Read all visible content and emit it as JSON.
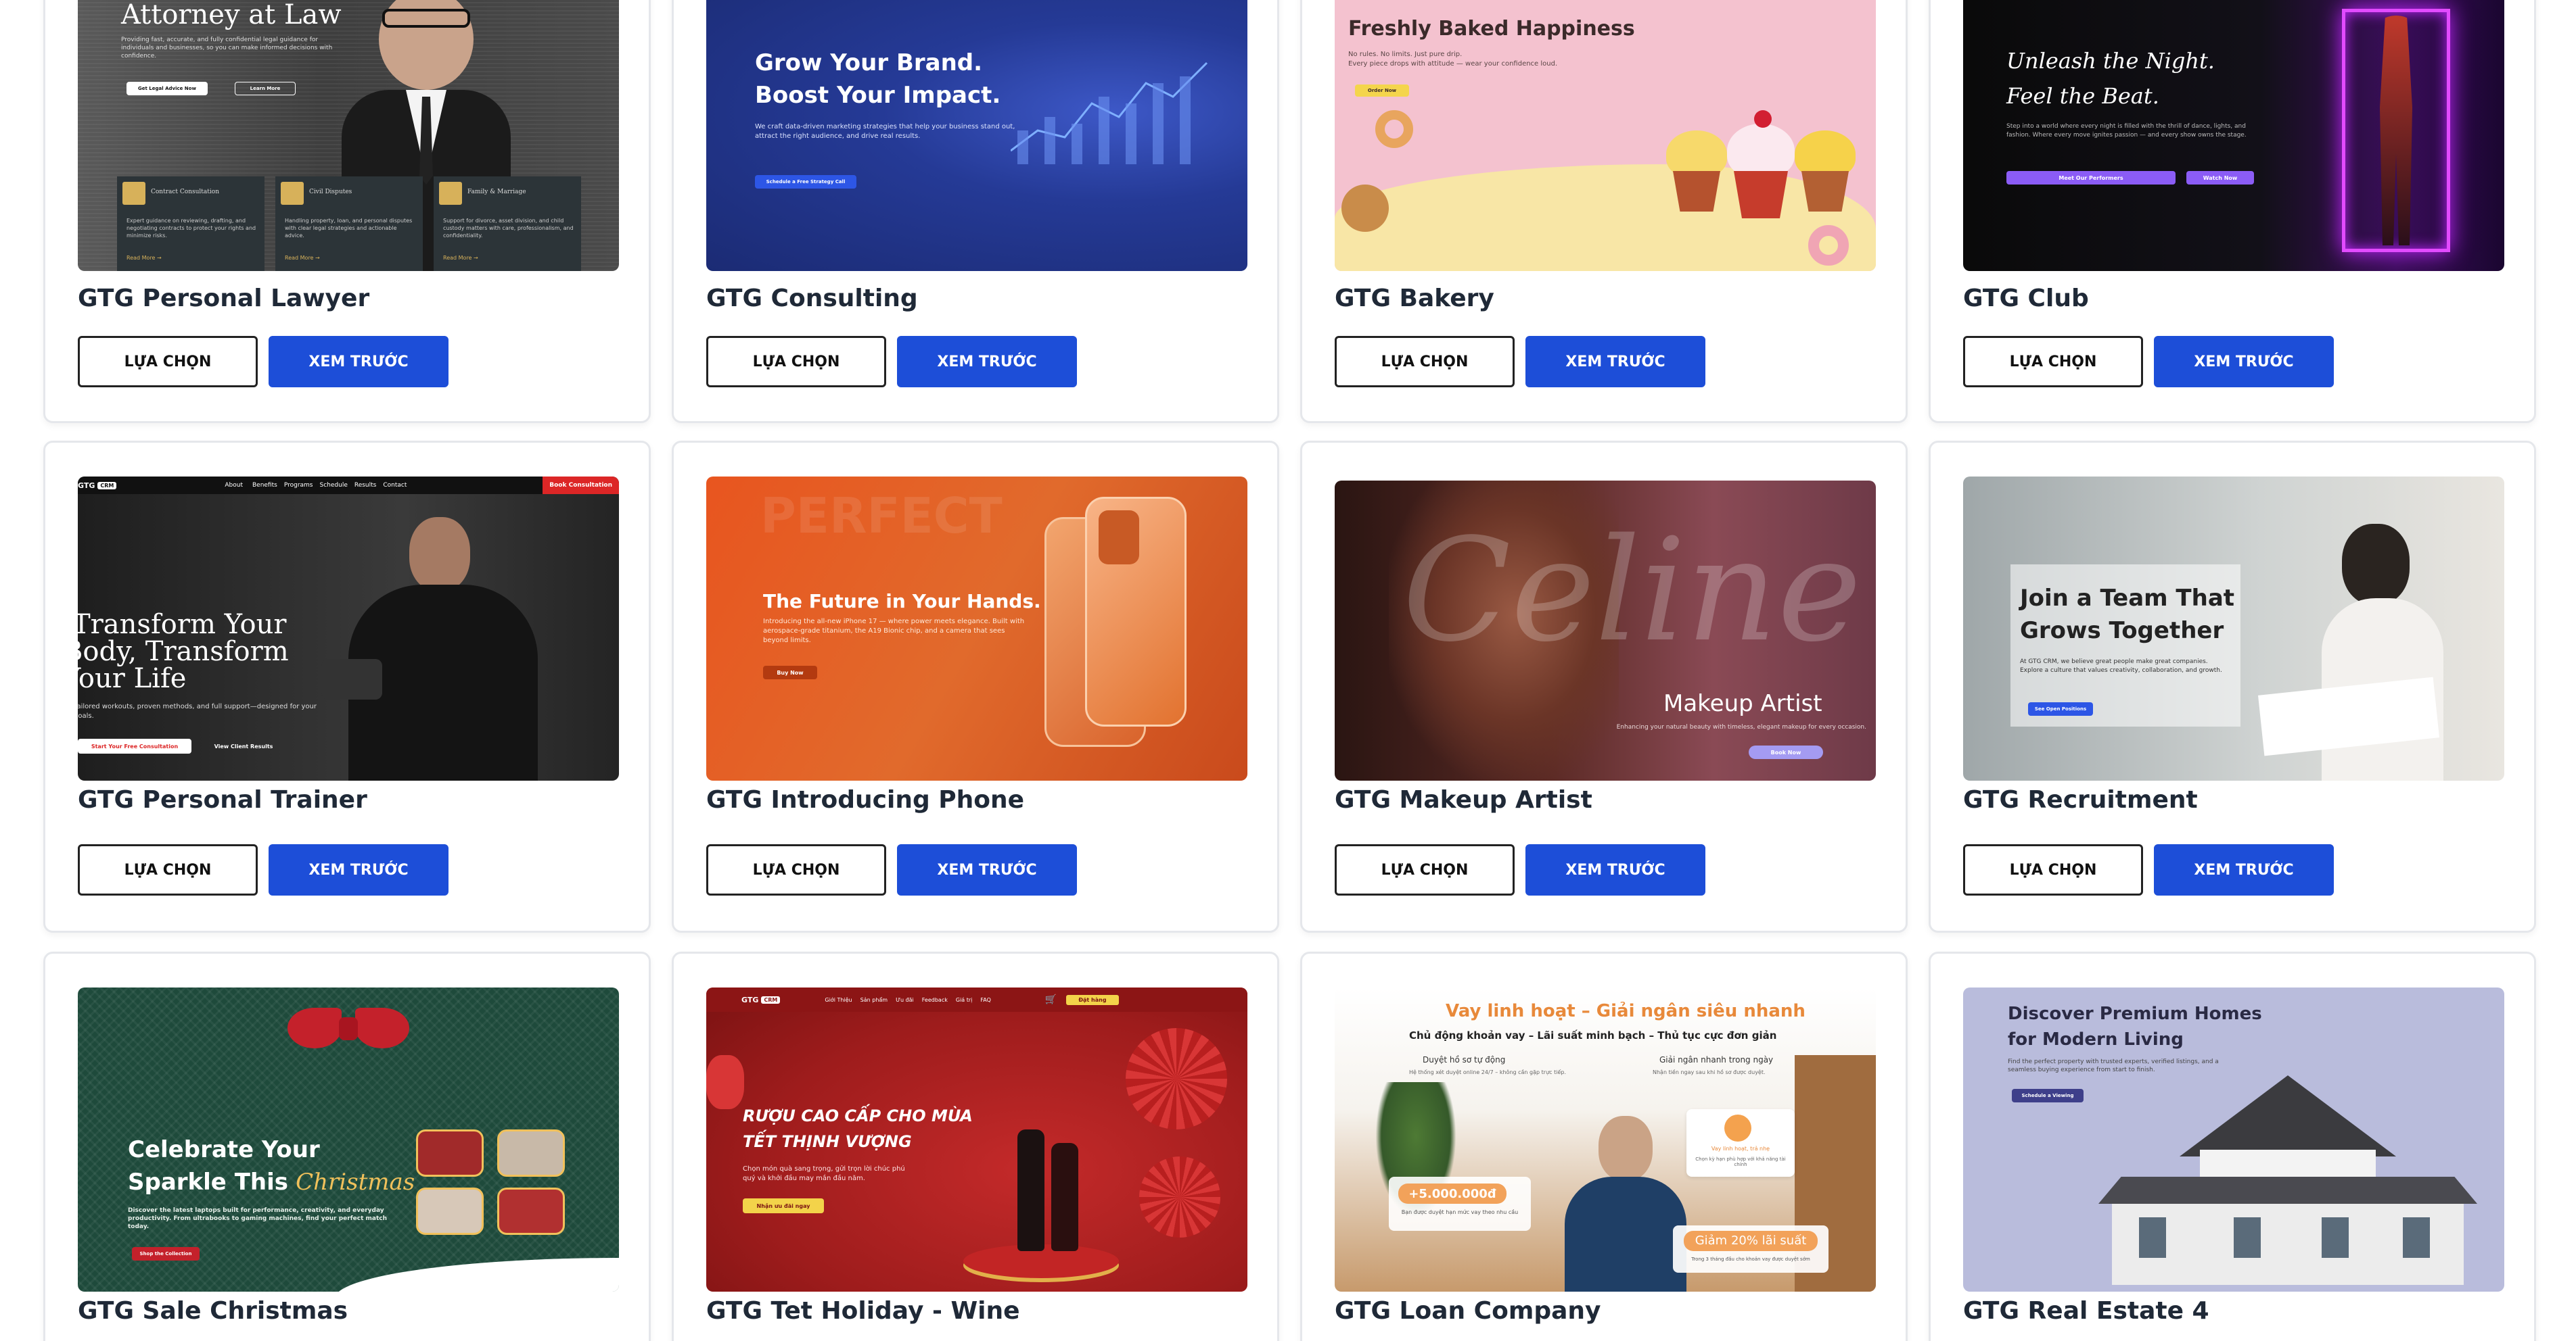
{
  "buttons": {
    "select": "LỰA CHỌN",
    "preview": "XEM TRƯỚC"
  },
  "templates": [
    {
      "name": "GTG Personal Lawyer",
      "hero": {
        "heading": "Attorney at Law",
        "text": "Providing fast, accurate, and fully confidential legal guidance for individuals and businesses, so you can make informed decisions with confidence.",
        "cta_primary": "Get Legal Advice Now",
        "cta_secondary": "Learn More",
        "services": [
          {
            "title": "Contract Consultation",
            "text": "Expert guidance on reviewing, drafting, and negotiating contracts to protect your rights and minimize risks.",
            "link": "Read More →"
          },
          {
            "title": "Civil Disputes",
            "text": "Handling property, loan, and personal disputes with clear legal strategies and actionable advice.",
            "link": "Read More →"
          },
          {
            "title": "Family & Marriage",
            "text": "Support for divorce, asset division, and child custody matters with care, professionalism, and confidentiality.",
            "link": "Read More →"
          }
        ]
      }
    },
    {
      "name": "GTG Consulting",
      "hero": {
        "heading_1": "Grow Your Brand.",
        "heading_2": "Boost Your Impact.",
        "text": "We craft data-driven marketing strategies that help your business stand out, attract the right audience, and drive real results.",
        "cta": "Schedule a Free Strategy Call"
      }
    },
    {
      "name": "GTG Bakery",
      "hero": {
        "heading": "Freshly Baked Happiness",
        "text_1": "No rules. No limits. Just pure drip.",
        "text_2": "Every piece drops with attitude — wear your confidence loud.",
        "cta": "Order Now"
      }
    },
    {
      "name": "GTG Club",
      "hero": {
        "heading_1": "Unleash the Night.",
        "heading_2": "Feel the Beat.",
        "text": "Step into a world where every night is filled with the thrill of dance, lights, and fashion. Where every move ignites passion — and every show owns the stage.",
        "cta_primary": "Meet Our Performers",
        "cta_secondary": "Watch Now"
      }
    },
    {
      "name": "GTG Personal Trainer",
      "hero": {
        "logo": "GTG",
        "logo_badge": "CRM",
        "nav": [
          "About",
          "Benefits",
          "Programs",
          "Schedule",
          "Results",
          "Contact"
        ],
        "nav_cta": "Book Consultation",
        "heading_1": "Transform Your",
        "heading_2": "Body, Transform",
        "heading_3": "Your Life",
        "text": "Tailored workouts, proven methods, and full support—designed for your goals.",
        "cta_primary": "Start Your Free Consultation",
        "cta_secondary": "View Client Results"
      }
    },
    {
      "name": "GTG Introducing Phone",
      "hero": {
        "watermark": "PERFECT",
        "heading": "The Future in Your Hands.",
        "text": "Introducing the all-new iPhone 17 — where power meets elegance. Built with aerospace-grade titanium, the A19 Bionic chip, and a camera that sees beyond limits.",
        "cta": "Buy Now"
      }
    },
    {
      "name": "GTG Makeup Artist",
      "hero": {
        "script": "Celine",
        "heading": "Makeup Artist",
        "text": "Enhancing your natural beauty with timeless, elegant makeup for every occasion.",
        "cta": "Book Now"
      }
    },
    {
      "name": "GTG Recruitment",
      "hero": {
        "heading_1": "Join a Team That",
        "heading_2": "Grows Together",
        "text": "At GTG CRM, we believe great people make great companies. Explore a culture that values creativity, collaboration, and growth.",
        "cta": "See Open Positions"
      }
    },
    {
      "name": "GTG Sale Christmas",
      "hero": {
        "heading_1": "Celebrate Your",
        "heading_2": "Sparkle This",
        "heading_script": "Christmas",
        "text": "Discover the latest laptops built for performance, creativity, and everyday productivity. From ultrabooks to gaming machines, find your perfect match today.",
        "cta": "Shop the Collection"
      }
    },
    {
      "name": "GTG Tet Holiday - Wine",
      "hero": {
        "logo": "GTG",
        "logo_badge": "CRM",
        "nav": [
          "Giới Thiệu",
          "Sản phẩm",
          "Ưu đãi",
          "Feedback",
          "Giá trị",
          "FAQ"
        ],
        "nav_cta": "Đặt hàng",
        "heading_1": "RƯỢU CAO CẤP CHO MÙA",
        "heading_2": "TẾT THỊNH VƯỢNG",
        "text": "Chọn món quà sang trọng, gửi trọn lời chúc phú quý và khởi đầu may mắn đầu năm.",
        "cta": "Nhận ưu đãi ngay"
      }
    },
    {
      "name": "GTG Loan Company",
      "hero": {
        "heading": "Vay linh hoạt – Giải ngân siêu nhanh",
        "subheading": "Chủ động khoản vay – Lãi suất minh bạch – Thủ tục cực đơn giản",
        "feature_1_title": "Duyệt hồ sơ tự động",
        "feature_1_text": "Hệ thống xét duyệt online 24/7 – không cần gặp trực tiếp.",
        "feature_2_title": "Giải ngân nhanh trong ngày",
        "feature_2_text": "Nhận tiền ngay sau khi hồ sơ được duyệt.",
        "amount": "+5.000.000đ",
        "amount_text": "Bạn được duyệt hạn mức vay theo nhu cầu",
        "card_title": "Vay linh hoạt, trả nhẹ",
        "card_text": "Chọn kỳ hạn phù hợp với khả năng tài chính",
        "discount": "Giảm 20% lãi suất",
        "discount_text": "Trong 3 tháng đầu cho khoản vay được duyệt sớm"
      }
    },
    {
      "name": "GTG Real Estate 4",
      "hero": {
        "heading_1": "Discover Premium Homes",
        "heading_2": "for Modern Living",
        "text": "Find the perfect property with trusted experts, verified listings, and a seamless buying experience from start to finish.",
        "cta": "Schedule a Viewing"
      }
    }
  ]
}
